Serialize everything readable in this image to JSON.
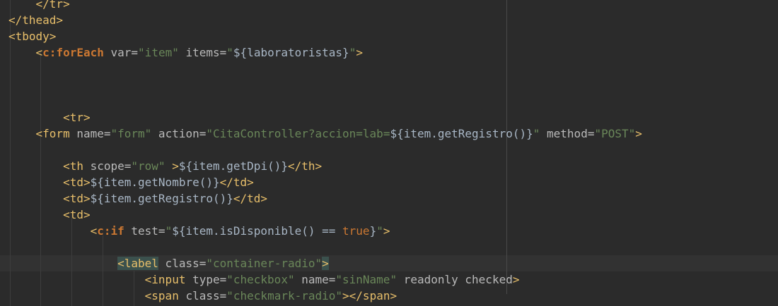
{
  "editor": {
    "lines": [
      {
        "indent": "    ",
        "tokens": [
          {
            "c": "tag",
            "t": "</tr>"
          }
        ]
      },
      {
        "indent": "",
        "tokens": [
          {
            "c": "tag",
            "t": "</thead>"
          }
        ]
      },
      {
        "indent": "",
        "tokens": [
          {
            "c": "tag",
            "t": "<tbody>"
          }
        ]
      },
      {
        "indent": "    ",
        "tokens": [
          {
            "c": "tag",
            "t": "<"
          },
          {
            "c": "kw",
            "t": "c:forEach"
          },
          {
            "c": "attr",
            "t": " var="
          },
          {
            "c": "str",
            "t": "\"item\""
          },
          {
            "c": "attr",
            "t": " items="
          },
          {
            "c": "str",
            "t": "\""
          },
          {
            "c": "el",
            "t": "${laboratoristas}"
          },
          {
            "c": "str",
            "t": "\""
          },
          {
            "c": "tag",
            "t": ">"
          }
        ]
      },
      {
        "indent": "",
        "tokens": []
      },
      {
        "indent": "",
        "tokens": []
      },
      {
        "indent": "",
        "tokens": []
      },
      {
        "indent": "        ",
        "tokens": [
          {
            "c": "tag",
            "t": "<tr>"
          }
        ]
      },
      {
        "indent": "    ",
        "tokens": [
          {
            "c": "tag",
            "t": "<form"
          },
          {
            "c": "attr",
            "t": " name="
          },
          {
            "c": "str",
            "t": "\"form\""
          },
          {
            "c": "attr",
            "t": " action="
          },
          {
            "c": "str",
            "t": "\"CitaController?accion=lab="
          },
          {
            "c": "el",
            "t": "${item.getRegistro()}"
          },
          {
            "c": "str",
            "t": "\""
          },
          {
            "c": "attr",
            "t": " method="
          },
          {
            "c": "str",
            "t": "\"POST\""
          },
          {
            "c": "tag",
            "t": ">"
          }
        ]
      },
      {
        "indent": "",
        "tokens": []
      },
      {
        "indent": "        ",
        "tokens": [
          {
            "c": "tag",
            "t": "<th"
          },
          {
            "c": "attr",
            "t": " scope="
          },
          {
            "c": "str",
            "t": "\"row\""
          },
          {
            "c": "tag",
            "t": " >"
          },
          {
            "c": "el",
            "t": "${item.getDpi()}"
          },
          {
            "c": "tag",
            "t": "</th>"
          }
        ]
      },
      {
        "indent": "        ",
        "tokens": [
          {
            "c": "tag",
            "t": "<td>"
          },
          {
            "c": "el",
            "t": "${item.getNombre()}"
          },
          {
            "c": "tag",
            "t": "</td>"
          }
        ]
      },
      {
        "indent": "        ",
        "tokens": [
          {
            "c": "tag",
            "t": "<td>"
          },
          {
            "c": "el",
            "t": "${item.getRegistro()}"
          },
          {
            "c": "tag",
            "t": "</td>"
          }
        ]
      },
      {
        "indent": "        ",
        "tokens": [
          {
            "c": "tag",
            "t": "<td>"
          }
        ]
      },
      {
        "indent": "            ",
        "tokens": [
          {
            "c": "tag",
            "t": "<"
          },
          {
            "c": "kw",
            "t": "c:if"
          },
          {
            "c": "attr",
            "t": " test="
          },
          {
            "c": "str",
            "t": "\""
          },
          {
            "c": "el",
            "t": "${item.isDisponible() "
          },
          {
            "c": "op",
            "t": "=="
          },
          {
            "c": "el",
            "t": " "
          },
          {
            "c": "bool",
            "t": "true"
          },
          {
            "c": "el",
            "t": "}"
          },
          {
            "c": "str",
            "t": "\""
          },
          {
            "c": "tag",
            "t": ">"
          }
        ]
      },
      {
        "indent": "",
        "tokens": []
      },
      {
        "indent": "                ",
        "hl": true,
        "tokens": [
          {
            "c": "tag tag-hl",
            "t": "<label"
          },
          {
            "c": "attr",
            "t": " class="
          },
          {
            "c": "str",
            "t": "\"container-radio\""
          },
          {
            "c": "tag tag-hl",
            "t": ">"
          }
        ]
      },
      {
        "indent": "                    ",
        "tokens": [
          {
            "c": "tag",
            "t": "<input"
          },
          {
            "c": "attr",
            "t": " type="
          },
          {
            "c": "str",
            "t": "\"checkbox\""
          },
          {
            "c": "attr",
            "t": " name="
          },
          {
            "c": "str",
            "t": "\"sinName\""
          },
          {
            "c": "attr",
            "t": " readonly checked"
          },
          {
            "c": "tag",
            "t": ">"
          }
        ]
      },
      {
        "indent": "                    ",
        "tokens": [
          {
            "c": "tag",
            "t": "<span"
          },
          {
            "c": "attr",
            "t": " class="
          },
          {
            "c": "str",
            "t": "\"checkmark-radio\""
          },
          {
            "c": "tag",
            "t": "></span>"
          }
        ]
      }
    ]
  }
}
